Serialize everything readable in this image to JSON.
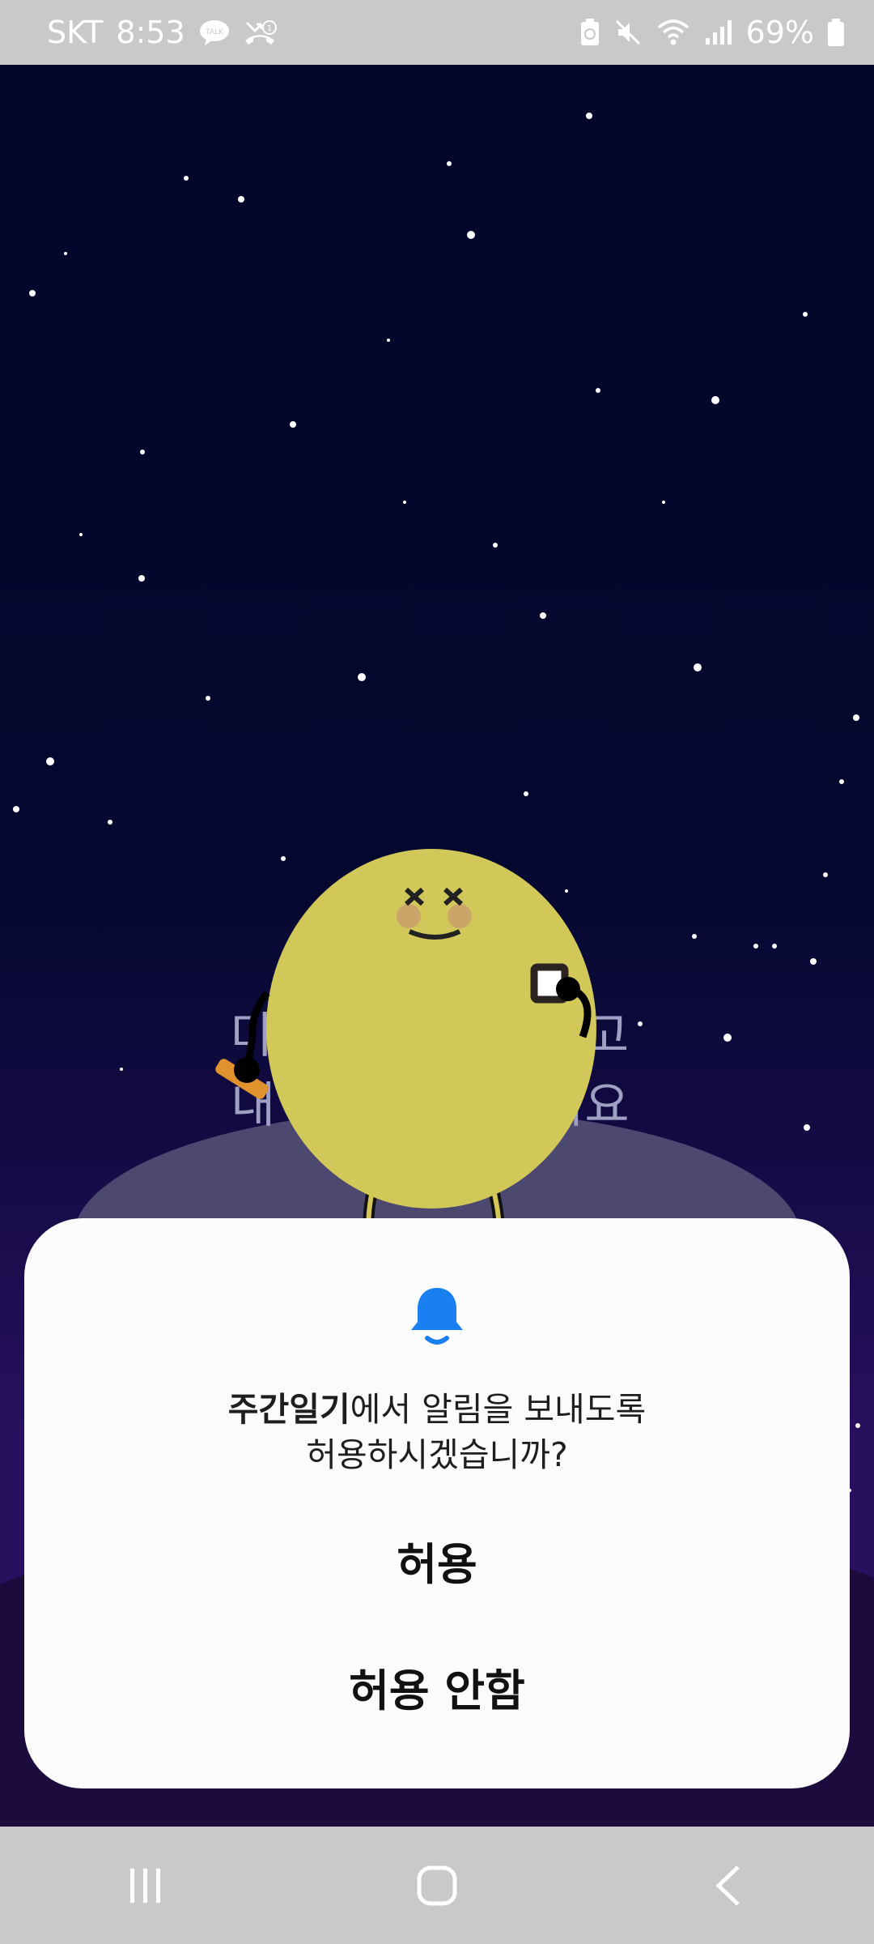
{
  "status_bar": {
    "carrier": "SKT",
    "time": "8:53",
    "battery_percent": "69%",
    "icons": [
      "talk-icon",
      "missed-call-icon",
      "battery-saver-icon",
      "mute-icon",
      "wifi-icon",
      "signal-icon",
      "battery-icon"
    ]
  },
  "background": {
    "line1": "마",
    "line1_right": "고",
    "line2_left": "내 상",
    "line2_right": "간해요"
  },
  "dialog": {
    "icon": "bell-icon",
    "app_name": "주간일기",
    "message_rest": "에서 알림을 보내도록",
    "message_line2": "허용하시겠습니까?",
    "allow_label": "허용",
    "deny_label": "허용 안함",
    "accent_color": "#1a7ff0"
  },
  "nav_bar": {
    "icons": [
      "recent-apps-icon",
      "home-icon",
      "back-icon"
    ]
  }
}
